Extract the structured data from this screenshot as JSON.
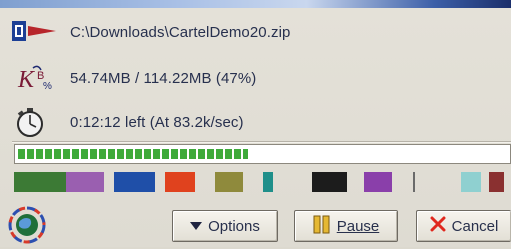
{
  "download": {
    "file_path": "C:\\Downloads\\CartelDemo20.zip",
    "progress_text": "54.74MB / 114.22MB (47%)",
    "time_text": "0:12:12 left  (At 83.2k/sec)",
    "progress_fraction": 0.47
  },
  "segments": [
    {
      "color": "#3c7a35",
      "start": 0.0,
      "end": 0.104
    },
    {
      "color": "#9a5fb0",
      "start": 0.104,
      "end": 0.18
    },
    {
      "color": "#1f4fa8",
      "start": 0.202,
      "end": 0.284
    },
    {
      "color": "#e0421e",
      "start": 0.304,
      "end": 0.364
    },
    {
      "color": "#8f8a3c",
      "start": 0.404,
      "end": 0.46
    },
    {
      "color": "#1f8f8a",
      "start": 0.5,
      "end": 0.52
    },
    {
      "color": "#1c1c1c",
      "start": 0.6,
      "end": 0.67
    },
    {
      "color": "#8a3faa",
      "start": 0.704,
      "end": 0.76
    },
    {
      "color": "#6a6a6a",
      "start": 0.802,
      "end": 0.806
    },
    {
      "color": "#8fd0d0",
      "start": 0.9,
      "end": 0.94
    },
    {
      "color": "#8a3030",
      "start": 0.955,
      "end": 0.985
    }
  ],
  "buttons": {
    "options_label": "Options",
    "pause_label": "Pause",
    "cancel_label": "Cancel"
  },
  "icons": {
    "file": "file-type-icon",
    "size": "data-transfer-icon",
    "time": "stopwatch-icon",
    "globe": "globe-icon",
    "options": "triangle-down-icon",
    "pause": "pause-icon",
    "cancel": "cancel-x-icon"
  },
  "colors": {
    "progress_fill": "#3eaa3a",
    "cancel_x": "#e0281e",
    "pause_bars": "#e5b833"
  }
}
